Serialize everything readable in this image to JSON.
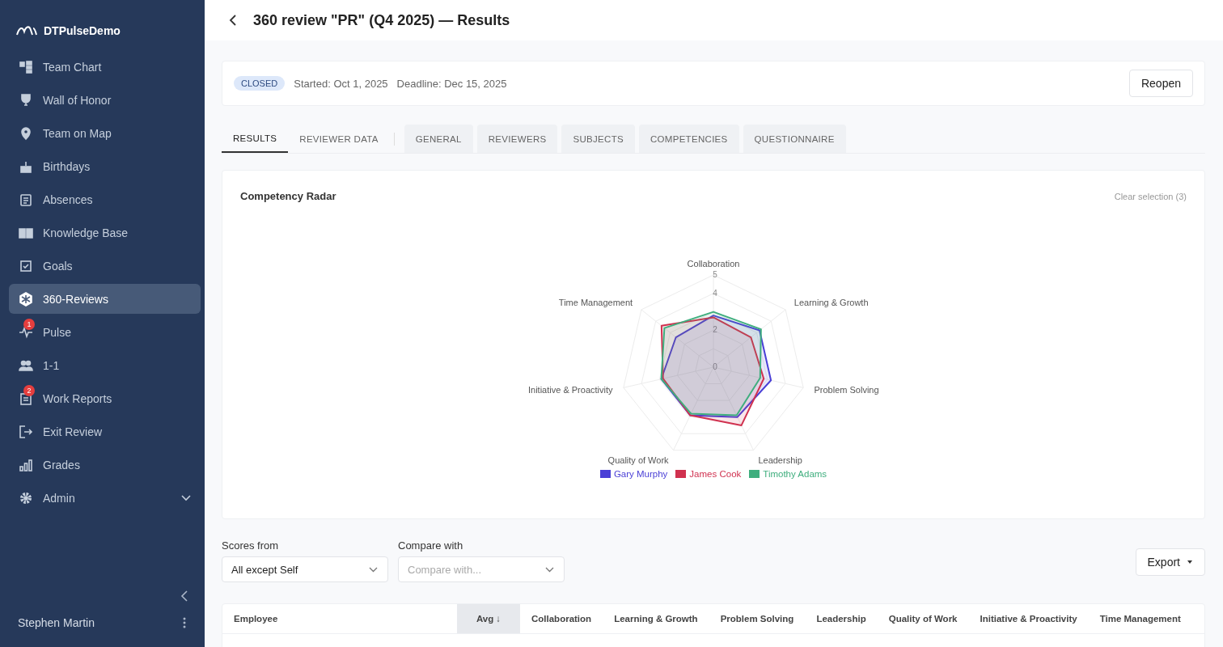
{
  "sidebar": {
    "brand": "DTPulseDemo",
    "items": [
      {
        "label": "Team Chart",
        "selected": false
      },
      {
        "label": "Wall of Honor",
        "selected": false
      },
      {
        "label": "Team on Map",
        "selected": false
      },
      {
        "label": "Birthdays",
        "selected": false
      },
      {
        "label": "Absences",
        "selected": false
      },
      {
        "label": "Knowledge Base",
        "selected": false
      },
      {
        "label": "Goals",
        "selected": false
      },
      {
        "label": "360-Reviews",
        "selected": true
      },
      {
        "label": "Pulse",
        "selected": false,
        "badge": "1"
      },
      {
        "label": "1-1",
        "selected": false
      },
      {
        "label": "Work Reports",
        "selected": false,
        "badge": "2"
      },
      {
        "label": "Exit Review",
        "selected": false
      },
      {
        "label": "Grades",
        "selected": false
      },
      {
        "label": "Admin",
        "selected": false,
        "expandable": true
      }
    ],
    "user": "Stephen Martin"
  },
  "header": {
    "title": "360 review \"PR\" (Q4 2025) — Results"
  },
  "info": {
    "status": "CLOSED",
    "started": "Started: Oct 1, 2025",
    "deadline": "Deadline: Dec 15, 2025",
    "action": "Reopen"
  },
  "tabs": [
    {
      "label": "RESULTS",
      "selected": true,
      "kind": "plain"
    },
    {
      "label": "REVIEWER DATA",
      "selected": false,
      "kind": "plain"
    },
    {
      "label": "GENERAL",
      "selected": false,
      "kind": "filled"
    },
    {
      "label": "REVIEWERS",
      "selected": false,
      "kind": "filled"
    },
    {
      "label": "SUBJECTS",
      "selected": false,
      "kind": "filled"
    },
    {
      "label": "COMPETENCIES",
      "selected": false,
      "kind": "filled"
    },
    {
      "label": "QUESTIONNAIRE",
      "selected": false,
      "kind": "filled"
    }
  ],
  "radar": {
    "title": "Competency Radar",
    "clear": "Clear selection (3)",
    "chart_data": {
      "type": "radar",
      "categories": [
        "Collaboration",
        "Learning & Growth",
        "Problem Solving",
        "Leadership",
        "Quality of Work",
        "Initiative & Proactivity",
        "Time Management"
      ],
      "ylim": [
        0,
        5
      ],
      "yticks": [
        0,
        2,
        4,
        5
      ],
      "legend": true,
      "series": [
        {
          "name": "Gary Murphy",
          "color": "#4a3fd6",
          "values": [
            2.8,
            3.2,
            3.2,
            3.0,
            2.9,
            2.9,
            2.6
          ]
        },
        {
          "name": "James Cook",
          "color": "#d0314f",
          "values": [
            2.7,
            2.6,
            2.8,
            3.5,
            2.9,
            2.8,
            3.6
          ]
        },
        {
          "name": "Timothy Adams",
          "color": "#3fae7e",
          "values": [
            3.0,
            3.3,
            2.6,
            2.9,
            2.8,
            2.9,
            3.4
          ]
        }
      ]
    }
  },
  "filters": [
    {
      "label": "Scores from",
      "value": "All except Self"
    },
    {
      "label": "Compare with",
      "placeholder": "Compare with..."
    }
  ],
  "export": "Export",
  "table": {
    "columns": [
      {
        "label": "Employee",
        "sorted": false
      },
      {
        "label": "Avg ↓",
        "sorted": true
      },
      {
        "label": "Collaboration",
        "sorted": false
      },
      {
        "label": "Learning & Growth",
        "sorted": false
      },
      {
        "label": "Problem Solving",
        "sorted": false
      },
      {
        "label": "Leadership",
        "sorted": false
      },
      {
        "label": "Quality of Work",
        "sorted": false
      },
      {
        "label": "Initiative & Proactivity",
        "sorted": false
      },
      {
        "label": "Time Management",
        "sorted": false
      }
    ]
  }
}
